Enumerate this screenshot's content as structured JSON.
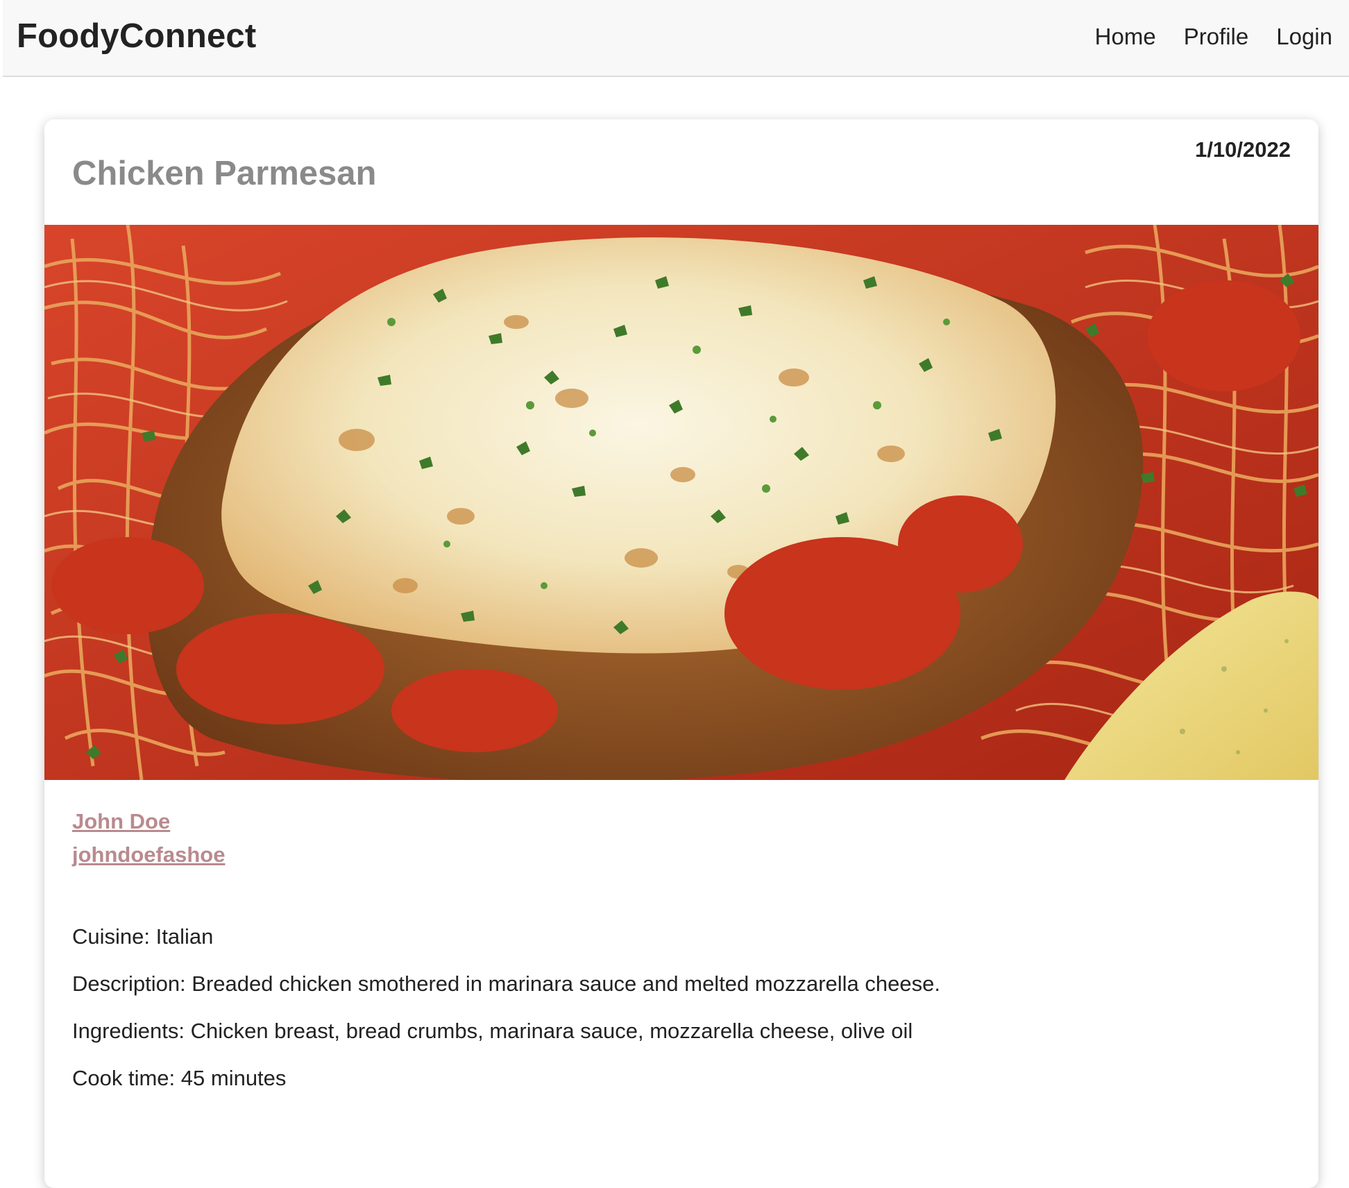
{
  "navbar": {
    "brand": "FoodyConnect",
    "links": [
      {
        "label": "Home"
      },
      {
        "label": "Profile"
      },
      {
        "label": "Login"
      }
    ]
  },
  "recipe": {
    "title": "Chicken Parmesan",
    "date": "1/10/2022",
    "author": {
      "name": "John Doe",
      "username": "johndoefashoe"
    },
    "details": {
      "cuisine": "Cuisine: Italian",
      "description": "Description: Breaded chicken smothered in marinara sauce and melted mozzarella cheese.",
      "ingredients": "Ingredients: Chicken breast, bread crumbs, marinara sauce, mozzarella cheese, olive oil",
      "cook_time": "Cook time: 45 minutes"
    }
  },
  "colors": {
    "author_link": "#b98a8e",
    "title": "#8a8a8a",
    "navbar_bg": "#f8f8f8"
  }
}
